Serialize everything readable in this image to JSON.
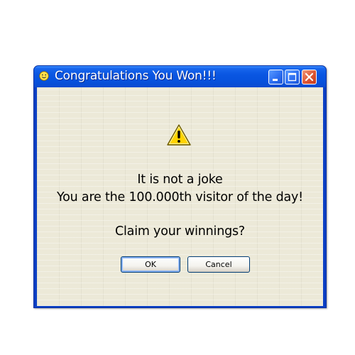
{
  "window": {
    "title": "Congratulations You Won!!!"
  },
  "icons": {
    "app": "smiley-icon",
    "dialog": "warning-icon",
    "minimize": "minimize-icon",
    "maximize": "maximize-icon",
    "close": "close-icon"
  },
  "message": {
    "line1": "It is not a joke",
    "line2": "You are the 100.000th visitor of the day!",
    "question": "Claim your winnings?"
  },
  "buttons": {
    "ok_label": "OK",
    "cancel_label": "Cancel"
  },
  "colors": {
    "titlebar": "#0a56e2",
    "client": "#ece9d8",
    "close_button": "#dd5533"
  }
}
